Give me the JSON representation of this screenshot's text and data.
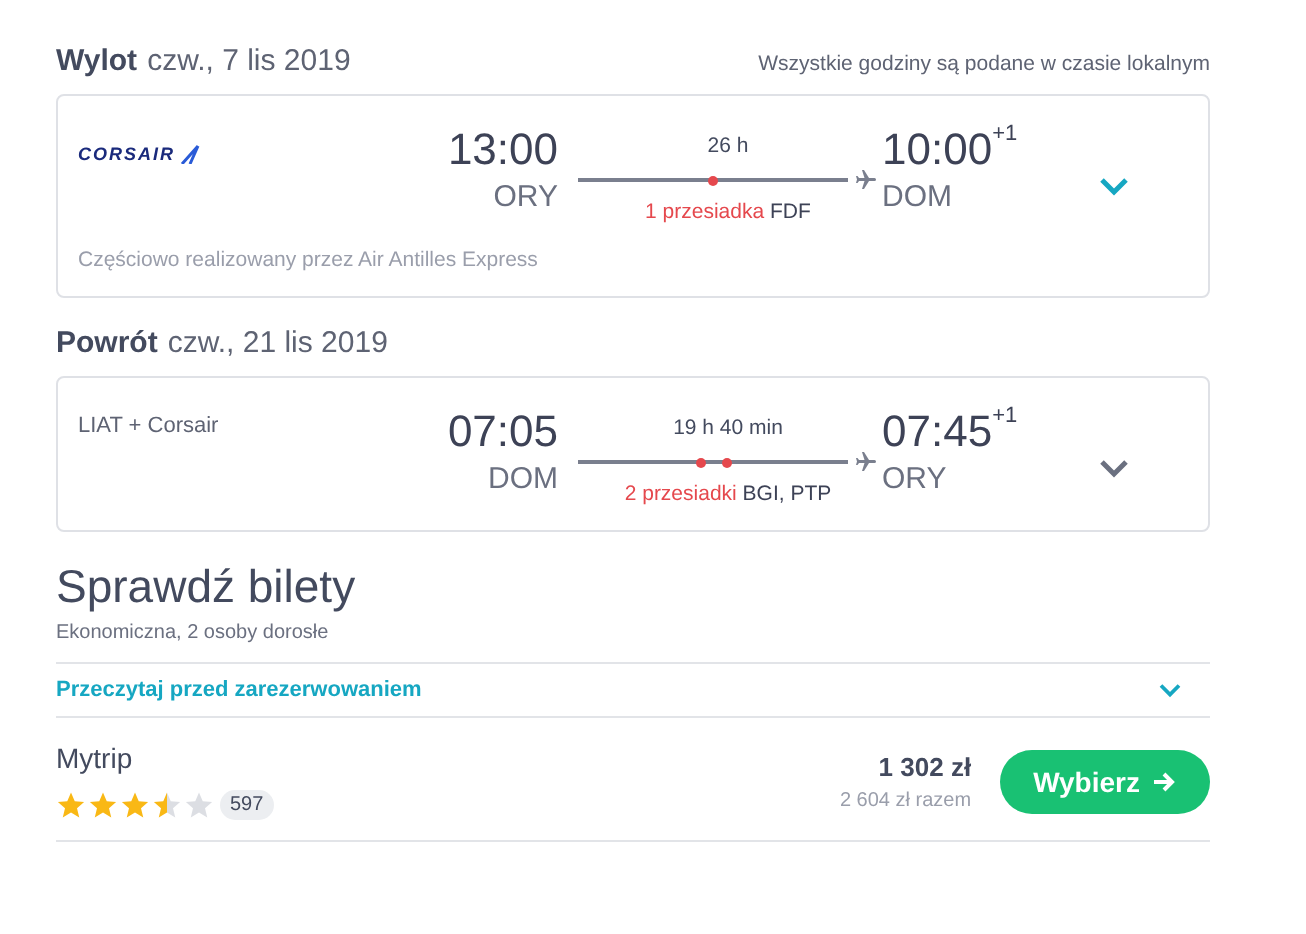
{
  "legs": [
    {
      "label": "Wylot",
      "date": "czw., 7 lis 2019",
      "note": "Wszystkie godziny są podane w czasie lokalnym",
      "carrier": {
        "kind": "logo",
        "text": "CORSAIR"
      },
      "depart": {
        "time": "13:00",
        "airport": "ORY"
      },
      "duration": "26 h",
      "stops_count": "1 przesiadka",
      "stops": [
        "FDF"
      ],
      "arrive": {
        "time": "10:00",
        "plus": "+1",
        "airport": "DOM"
      },
      "highlighted": true,
      "operated": "Częściowo realizowany przez Air Antilles Express"
    },
    {
      "label": "Powrót",
      "date": "czw., 21 lis 2019",
      "carrier": {
        "kind": "text",
        "text": "LIAT + Corsair"
      },
      "depart": {
        "time": "07:05",
        "airport": "DOM"
      },
      "duration": "19 h 40 min",
      "stops_count": "2 przesiadki",
      "stops": [
        "BGI,",
        "PTP"
      ],
      "arrive": {
        "time": "07:45",
        "plus": "+1",
        "airport": "ORY"
      },
      "highlighted": false
    }
  ],
  "tickets": {
    "title": "Sprawdź bilety",
    "subtitle": "Ekonomiczna, 2 osoby dorosłe",
    "notice": "Przeczytaj przed zarezerwowaniem",
    "offers": [
      {
        "provider": "Mytrip",
        "stars": 3.5,
        "reviews": "597",
        "price": "1 302 zł",
        "total": "2 604 zł razem",
        "button": "Wybierz"
      }
    ]
  }
}
